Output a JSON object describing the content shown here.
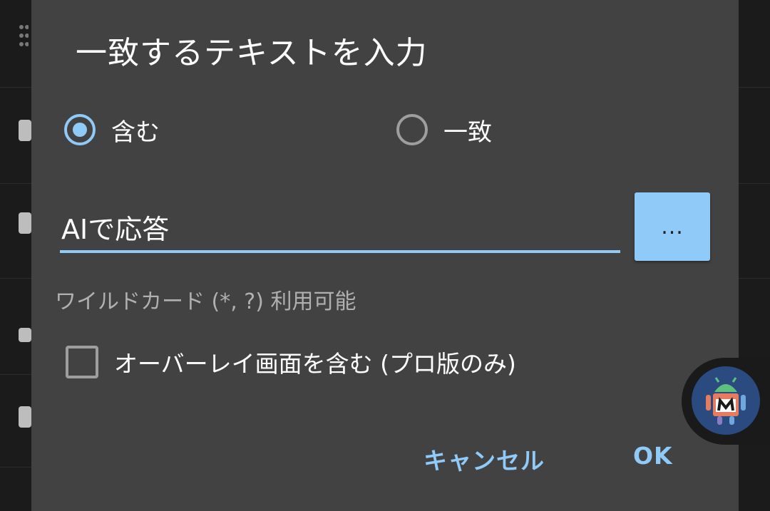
{
  "dialog": {
    "title": "一致するテキストを入力",
    "options": {
      "contains_label": "含む",
      "exact_label": "一致",
      "selected": "contains"
    },
    "input": {
      "value": "AIで応答"
    },
    "more_button_label": "...",
    "hint": "ワイルドカード (*, ?) 利用可能",
    "overlay_checkbox": {
      "label": "オーバーレイ画面を含む (プロ版のみ)",
      "checked": false
    },
    "actions": {
      "cancel_label": "キャンセル",
      "ok_label": "OK"
    }
  },
  "icons": {
    "floating_badge": "android-robot-icon"
  },
  "colors": {
    "accent": "#90caf9",
    "dialog_bg": "#424242"
  }
}
